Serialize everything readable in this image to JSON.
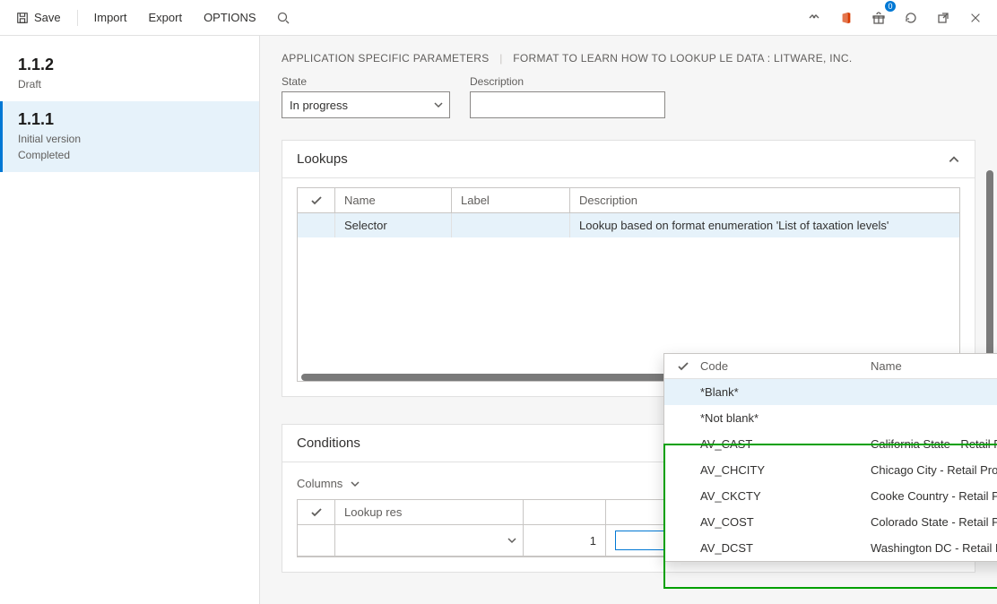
{
  "toolbar": {
    "save": "Save",
    "import": "Import",
    "export": "Export",
    "options": "OPTIONS",
    "notification_count": "0"
  },
  "sidebar": {
    "items": [
      {
        "version": "1.1.2",
        "line1": "Draft",
        "line2": ""
      },
      {
        "version": "1.1.1",
        "line1": "Initial version",
        "line2": "Completed"
      }
    ]
  },
  "breadcrumb": {
    "a": "APPLICATION SPECIFIC PARAMETERS",
    "b": "FORMAT TO LEARN HOW TO LOOKUP LE DATA : LITWARE, INC."
  },
  "form": {
    "state_label": "State",
    "state_value": "In progress",
    "desc_label": "Description",
    "desc_value": ""
  },
  "lookups": {
    "title": "Lookups",
    "headers": {
      "name": "Name",
      "label": "Label",
      "desc": "Description"
    },
    "rows": [
      {
        "name": "Selector",
        "label": "",
        "desc": "Lookup based on format enumeration 'List of taxation levels'"
      }
    ]
  },
  "conditions": {
    "title": "Conditions",
    "columns_label": "Columns",
    "headers": {
      "lookup": "Lookup res",
      "line": "",
      "code": ""
    },
    "edit_row": {
      "line": "1",
      "code_value": ""
    }
  },
  "dropdown": {
    "headers": {
      "code": "Code",
      "name": "Name"
    },
    "rows": [
      {
        "code": "*Blank*",
        "name": ""
      },
      {
        "code": "*Not blank*",
        "name": ""
      },
      {
        "code": "AV_CAST",
        "name": "California State - Retail Prod"
      },
      {
        "code": "AV_CHCITY",
        "name": "Chicago City - Retail Prod"
      },
      {
        "code": "AV_CKCTY",
        "name": "Cooke Country - Retail Prod"
      },
      {
        "code": "AV_COST",
        "name": "Colorado State - Retail Prod"
      },
      {
        "code": "AV_DCST",
        "name": "Washington DC - Retail Prod"
      }
    ]
  }
}
